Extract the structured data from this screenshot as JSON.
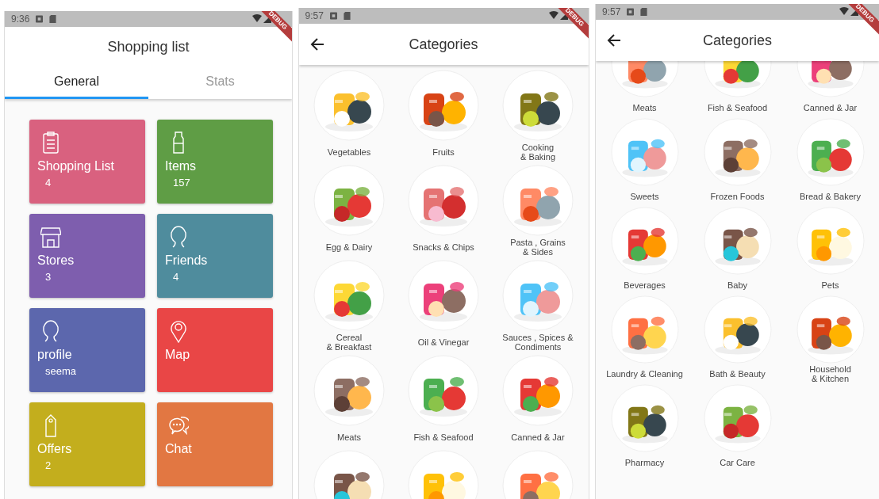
{
  "screens": [
    {
      "status_bar": {
        "time": "9:36",
        "ribbon": "DEBUG"
      },
      "title": "Shopping list",
      "tabs": [
        {
          "label": "General",
          "selected": true
        },
        {
          "label": "Stats",
          "selected": false
        }
      ],
      "tiles": [
        {
          "title": "Shopping List",
          "subtitle": "4",
          "color": "#d9617f"
        },
        {
          "title": "Items",
          "subtitle": "157",
          "color": "#5f9d45"
        },
        {
          "title": "Stores",
          "subtitle": "3",
          "color": "#7e5eae"
        },
        {
          "title": "Friends",
          "subtitle": "4",
          "color": "#4f8c9d"
        },
        {
          "title": "profile",
          "subtitle": "seema",
          "color": "#5c67ad"
        },
        {
          "title": "Map",
          "color": "#e94646"
        },
        {
          "title": "Offers",
          "subtitle": "2",
          "color": "#c3ae1d"
        },
        {
          "title": "Chat",
          "color": "#e27742"
        }
      ]
    },
    {
      "status_bar": {
        "time": "9:57",
        "ribbon": "DEBUG"
      },
      "title": "Categories",
      "scrolled": false,
      "items": [
        {
          "kind": "category",
          "label": "Vegetables"
        },
        {
          "kind": "category",
          "label": "Fruits"
        },
        {
          "kind": "category",
          "label": "Cooking\n& Baking"
        },
        {
          "kind": "category",
          "label": "Egg & Dairy"
        },
        {
          "kind": "category",
          "label": "Snacks & Chips"
        },
        {
          "kind": "category",
          "label": "Pasta , Grains\n& Sides"
        },
        {
          "kind": "category",
          "label": "Cereal\n& Breakfast"
        },
        {
          "kind": "category",
          "label": "Oil & Vinegar"
        },
        {
          "kind": "category",
          "label": "Sauces , Spices &\nCondiments"
        },
        {
          "kind": "category",
          "label": "Meats"
        },
        {
          "kind": "category",
          "label": "Fish & Seafood"
        },
        {
          "kind": "category",
          "label": "Canned & Jar"
        },
        {
          "kind": "picture"
        },
        {
          "kind": "picture"
        },
        {
          "kind": "picture"
        }
      ]
    },
    {
      "status_bar": {
        "time": "9:57",
        "ribbon": "DEBUG"
      },
      "title": "Categories",
      "scrolled": true,
      "items": [
        {
          "kind": "category",
          "label": "Meats"
        },
        {
          "kind": "category",
          "label": "Fish & Seafood"
        },
        {
          "kind": "category",
          "label": "Canned & Jar"
        },
        {
          "kind": "category",
          "label": "Sweets"
        },
        {
          "kind": "category",
          "label": "Frozen Foods"
        },
        {
          "kind": "category",
          "label": "Bread & Bakery"
        },
        {
          "kind": "category",
          "label": "Beverages"
        },
        {
          "kind": "category",
          "label": "Baby"
        },
        {
          "kind": "category",
          "label": "Pets"
        },
        {
          "kind": "category",
          "label": "Laundry & Cleaning"
        },
        {
          "kind": "category",
          "label": "Bath & Beauty"
        },
        {
          "kind": "category",
          "label": "Household\n&  Kitchen"
        },
        {
          "kind": "category",
          "label": "Pharmacy"
        },
        {
          "kind": "category",
          "label": "Car Care"
        }
      ]
    }
  ]
}
